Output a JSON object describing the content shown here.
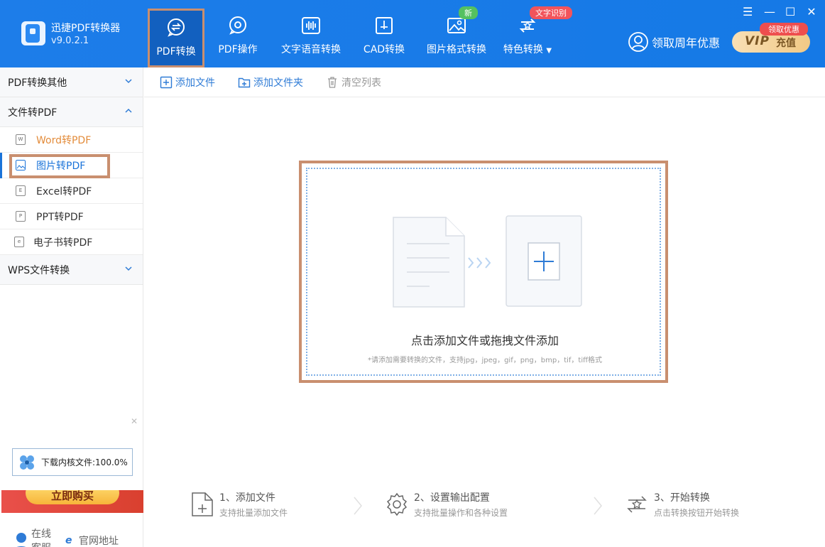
{
  "app": {
    "title": "迅捷PDF转换器",
    "version": "v9.0.2.1"
  },
  "nav": [
    {
      "label": "PDF转换",
      "icon": "pdf-convert-icon",
      "active": true
    },
    {
      "label": "PDF操作",
      "icon": "pdf-operation-icon"
    },
    {
      "label": "文字语音转换",
      "icon": "audio-wave-icon"
    },
    {
      "label": "CAD转换",
      "icon": "cad-icon"
    },
    {
      "label": "图片格式转换",
      "icon": "image-icon",
      "badge": "新"
    },
    {
      "label": "特色转换",
      "icon": "special-convert-icon",
      "badge": "文字识别"
    }
  ],
  "header": {
    "anniversary": "领取周年优惠",
    "vip_label": "VIP",
    "vip_recharge": "充值",
    "vip_tag": "领取优惠"
  },
  "window_controls": [
    "menu-icon",
    "minimize-icon",
    "maximize-icon",
    "close-icon"
  ],
  "sidebar": {
    "sections": [
      {
        "label": "PDF转换其他",
        "expanded": false
      },
      {
        "label": "文件转PDF",
        "expanded": true
      },
      {
        "label": "WPS文件转换",
        "expanded": false
      }
    ],
    "items": [
      {
        "label": "Word转PDF",
        "icon_letter": "W"
      },
      {
        "label": "图片转PDF",
        "icon_letter": ""
      },
      {
        "label": "Excel转PDF",
        "icon_letter": "E"
      },
      {
        "label": "PPT转PDF",
        "icon_letter": "P"
      },
      {
        "label": "电子书转PDF",
        "icon_letter": "e"
      }
    ],
    "download_status": "下载内核文件:100.0%",
    "promo_button": "立即购买",
    "links": {
      "service": "在线客服",
      "website": "官网地址"
    }
  },
  "toolbar": {
    "add_file": "添加文件",
    "add_folder": "添加文件夹",
    "clear_list": "清空列表"
  },
  "dropzone": {
    "title": "点击添加文件或拖拽文件添加",
    "hint": "*请添加需要转换的文件，支持jpg，jpeg，gif，png，bmp，tif，tiff格式"
  },
  "steps": [
    {
      "title": "1、添加文件",
      "desc": "支持批量添加文件"
    },
    {
      "title": "2、设置输出配置",
      "desc": "支持批量操作和各种设置"
    },
    {
      "title": "3、开始转换",
      "desc": "点击转换按钮开始转换"
    }
  ],
  "colors": {
    "header_bg": "#1d7de9",
    "active_nav_bg": "#1260bf",
    "highlight_border": "#c98f6f",
    "link_blue": "#2e7bd6"
  }
}
